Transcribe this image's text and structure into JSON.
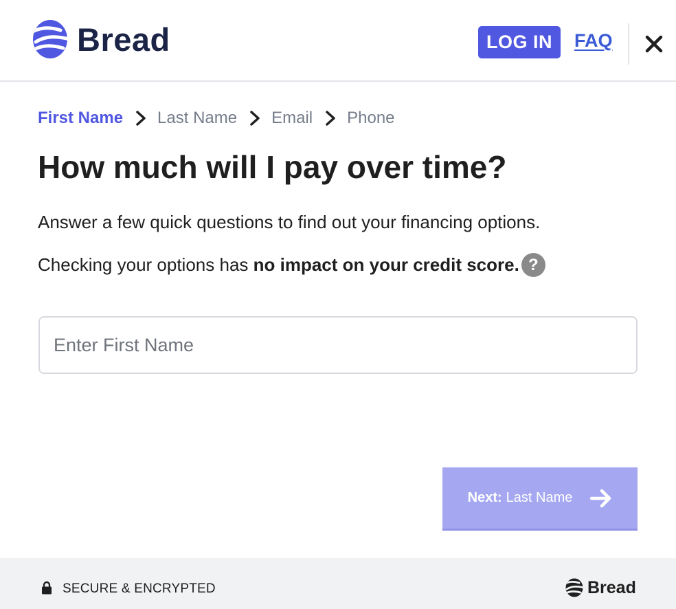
{
  "header": {
    "brand": "Bread",
    "login_label": "LOG IN",
    "faq_label": "FAQ",
    "brand_color": "#5057e0"
  },
  "breadcrumb": {
    "steps": [
      "First Name",
      "Last Name",
      "Email",
      "Phone"
    ],
    "active_index": 0
  },
  "main": {
    "title": "How much will I pay over time?",
    "intro": "Answer a few quick questions to find out your financing options.",
    "credit_prefix": "Checking your options has ",
    "credit_bold": "no impact on your credit score.",
    "help_glyph": "?",
    "first_name_placeholder": "Enter First Name",
    "first_name_value": ""
  },
  "next_button": {
    "bold": "Next:",
    "label": "Last Name"
  },
  "footer": {
    "secure_label": "SECURE & ENCRYPTED",
    "brand": "Bread"
  },
  "icons": {
    "logo": "bread-logo-icon",
    "close": "close-icon",
    "chevron": "chevron-right-icon",
    "help": "question-icon",
    "arrow": "arrow-right-icon",
    "lock": "lock-icon"
  }
}
